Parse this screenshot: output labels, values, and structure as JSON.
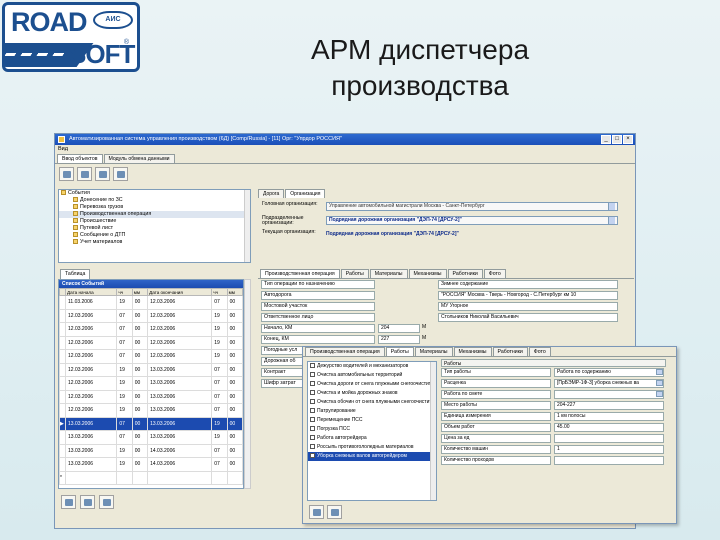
{
  "logo": {
    "road": "ROAD",
    "soft": "SOFT",
    "reg": "®",
    "emblem": "АИС"
  },
  "slide_title": "АРМ диспетчера производства",
  "window": {
    "title": "Автоматизированная система управления производством (6Д) [Comp/Russia] - [11] Орг: \"Упрдор РОССИЯ\"",
    "menu": "Вид",
    "tabs": [
      "Ввод объектов",
      "Модуль обмена данными"
    ],
    "controls": [
      "_",
      "□",
      "×"
    ]
  },
  "tree": {
    "items": [
      {
        "label": "События",
        "selected": false
      },
      {
        "label": "Донесение по ЗС",
        "selected": false
      },
      {
        "label": "Перевозка грузов",
        "selected": false
      },
      {
        "label": "Производственная операция",
        "selected": true
      },
      {
        "label": "Происшествие",
        "selected": false
      },
      {
        "label": "Путевой лист",
        "selected": false
      },
      {
        "label": "Сообщение о ДТП",
        "selected": false
      },
      {
        "label": "Учет материалов",
        "selected": false
      }
    ]
  },
  "org_form": {
    "tabs": [
      "Дорога",
      "Организация"
    ],
    "head_label": "Головная организация:",
    "head_value": "Управление автомобильной магистрали Москва - Санкт-Петербург",
    "sub_label": "Подразделенные организации:",
    "sub_value": "Подрядная дорожная организация \"ДЭП-74 [ДРСУ-2]\"",
    "current_label": "Текущая организация:",
    "current_value": "Подрядная дорожная организация \"ДЭП-74 [ДРСУ-2]\""
  },
  "events": {
    "tab": "Таблица",
    "caption": "Список Событий",
    "columns": [
      "",
      "Дата начала",
      "чч",
      "мм",
      "Дата окончания",
      "чч",
      "мм"
    ],
    "rows": [
      [
        "",
        "11.03.2006",
        "19",
        "00",
        "12.03.2006",
        "07",
        "00"
      ],
      [
        "",
        "12.03.2006",
        "07",
        "00",
        "12.03.2006",
        "19",
        "00"
      ],
      [
        "",
        "12.03.2006",
        "07",
        "00",
        "12.03.2006",
        "19",
        "00"
      ],
      [
        "",
        "12.03.2006",
        "07",
        "00",
        "12.03.2006",
        "19",
        "00"
      ],
      [
        "",
        "12.03.2006",
        "07",
        "00",
        "12.03.2006",
        "19",
        "00"
      ],
      [
        "",
        "12.03.2006",
        "19",
        "00",
        "13.03.2006",
        "07",
        "00"
      ],
      [
        "",
        "12.03.2006",
        "19",
        "00",
        "13.03.2006",
        "07",
        "00"
      ],
      [
        "",
        "12.03.2006",
        "19",
        "00",
        "13.03.2006",
        "07",
        "00"
      ],
      [
        "",
        "12.03.2006",
        "19",
        "00",
        "13.03.2006",
        "07",
        "00"
      ],
      [
        "▶",
        "13.03.2006",
        "07",
        "00",
        "13.03.2006",
        "19",
        "00"
      ],
      [
        "",
        "13.03.2006",
        "07",
        "00",
        "13.03.2006",
        "19",
        "00"
      ],
      [
        "",
        "13.03.2006",
        "19",
        "00",
        "14.03.2006",
        "07",
        "00"
      ],
      [
        "",
        "13.03.2006",
        "19",
        "00",
        "14.03.2006",
        "07",
        "00"
      ],
      [
        "*",
        "",
        "",
        "",
        "",
        "",
        ""
      ]
    ],
    "selected_row": 9
  },
  "works_panel": {
    "tabs": [
      "Производственная операция",
      "Работы",
      "Материалы",
      "Механизмы",
      "Работники",
      "Фото"
    ],
    "rows": [
      {
        "label": "Тип операции по назначению",
        "val": "",
        "val2": "Зимнее содержание"
      },
      {
        "label": "Автодорога",
        "val": "",
        "val2": "\"РОССИЯ\" Москва - Тверь - Новгород - С.Петербург км 10"
      },
      {
        "label": "Мостовой участок",
        "val": "",
        "val2": "МУ Угорное"
      },
      {
        "label": "Ответственное лицо",
        "val": "",
        "val2": "Стольников Николай Васильевич"
      },
      {
        "label": "Начало, КМ",
        "val": "204",
        "unit": "М",
        "val2": ""
      },
      {
        "label": "Конец, КМ",
        "val": "227",
        "unit": "М",
        "val2": ""
      },
      {
        "label": "Погодные усл",
        "val": "",
        "val2": ""
      },
      {
        "label": "Дорожная об",
        "val": "",
        "val2": ""
      },
      {
        "label": "Контракт",
        "val": "",
        "val2": ""
      },
      {
        "label": "Шифр затрат",
        "val": "",
        "val2": ""
      }
    ]
  },
  "win2": {
    "tabs": [
      "Производственная операция",
      "Работы",
      "Материалы",
      "Механизмы",
      "Работники",
      "Фото"
    ],
    "operations": [
      {
        "label": "Дежурство водителей и механизаторов",
        "selected": false
      },
      {
        "label": "Очистка автомобильных территорий",
        "selected": false
      },
      {
        "label": "Очистка дороги от снега плужными снегоочистителями",
        "selected": false
      },
      {
        "label": "Очистка и мойка дорожных знаков",
        "selected": false
      },
      {
        "label": "Очистка обочин от снега плужными снегоочистителями",
        "selected": false
      },
      {
        "label": "Патрулирование",
        "selected": false
      },
      {
        "label": "Перемещение ПСС",
        "selected": false
      },
      {
        "label": "Погрузка ПСС",
        "selected": false
      },
      {
        "label": "Работа автогрейдера",
        "selected": false
      },
      {
        "label": "Россыпь противогололедных материалов",
        "selected": false
      },
      {
        "label": "Уборка снежных валов автогрейдером",
        "selected": true
      }
    ],
    "props_header": "Работы",
    "props": [
      {
        "label": "Тип работы",
        "value": "Работа по содержанию",
        "btn": true
      },
      {
        "label": "Расценка",
        "value": "[ПрБЭМР-1Ф-3] уборка снежных ва",
        "btn": true
      },
      {
        "label": "Работа по смете",
        "value": "",
        "btn": true
      },
      {
        "label": "Место работы",
        "value": "204-227",
        "btn": false
      },
      {
        "label": "Единица измерения",
        "value": "1 км полосы",
        "btn": false
      },
      {
        "label": "Объем работ",
        "value": "45.00",
        "btn": false
      },
      {
        "label": "Цена за ед",
        "value": "",
        "btn": false
      },
      {
        "label": "Количество машин",
        "value": "1",
        "btn": false
      },
      {
        "label": "Количество проходов",
        "value": "",
        "btn": false
      }
    ]
  }
}
